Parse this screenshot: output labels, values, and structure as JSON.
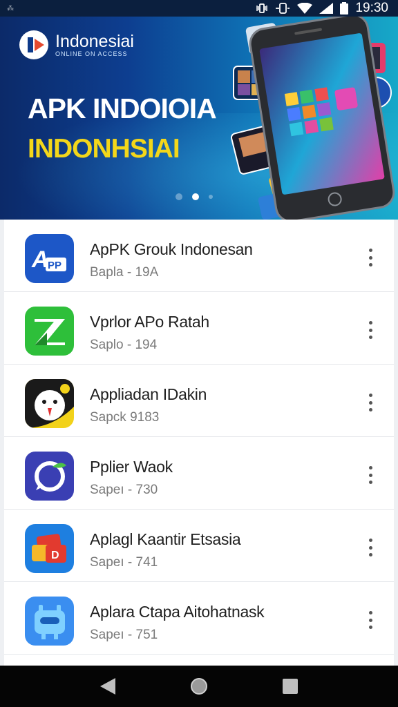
{
  "status_bar": {
    "left_glyph": "⁂",
    "time": "19:30",
    "icons": [
      "vibrate-icon",
      "battery-saver-icon",
      "wifi-icon",
      "signal-icon",
      "battery-icon"
    ]
  },
  "banner": {
    "brand_name": "Indonesiai",
    "brand_tagline": "ONLINE ON ACCESS",
    "headline": "APK INDOIOIA",
    "subline": "INDONHSIAI",
    "carousel_dots": 3,
    "carousel_active": 1,
    "colors": {
      "headline": "#ffffff",
      "subline": "#f3d71a",
      "background_start": "#0c2a69",
      "background_end": "#17a8c8"
    }
  },
  "apps": [
    {
      "title": "ApPK Grouk Indonesan",
      "subtitle": "Bapla - 19A",
      "icon": "app-pp-icon",
      "color": "#1d57c7"
    },
    {
      "title": "Vprlor APo Ratah",
      "subtitle": "Saplo - 194",
      "icon": "app-green-z-icon",
      "color": "#2ebf3a"
    },
    {
      "title": "Appliadan IDakin",
      "subtitle": "Sapck 9183",
      "icon": "app-owl-face-icon",
      "color": "#1a1a1a"
    },
    {
      "title": "Pplier Waok",
      "subtitle": "Sapeı - 730",
      "icon": "app-chat-bubble-icon",
      "color": "#3a3fb3"
    },
    {
      "title": "Aplagl Kaantir Etsasia",
      "subtitle": "Sapeı - 741",
      "icon": "app-cards-icon",
      "color": "#1e7fe0"
    },
    {
      "title": "Aplara Ctapa Aitohatnask",
      "subtitle": "Sapeı - 751",
      "icon": "app-robot-icon",
      "color": "#3a8ef0"
    }
  ],
  "nav_bar": {
    "buttons": [
      "back-icon",
      "home-icon",
      "recents-icon"
    ]
  }
}
